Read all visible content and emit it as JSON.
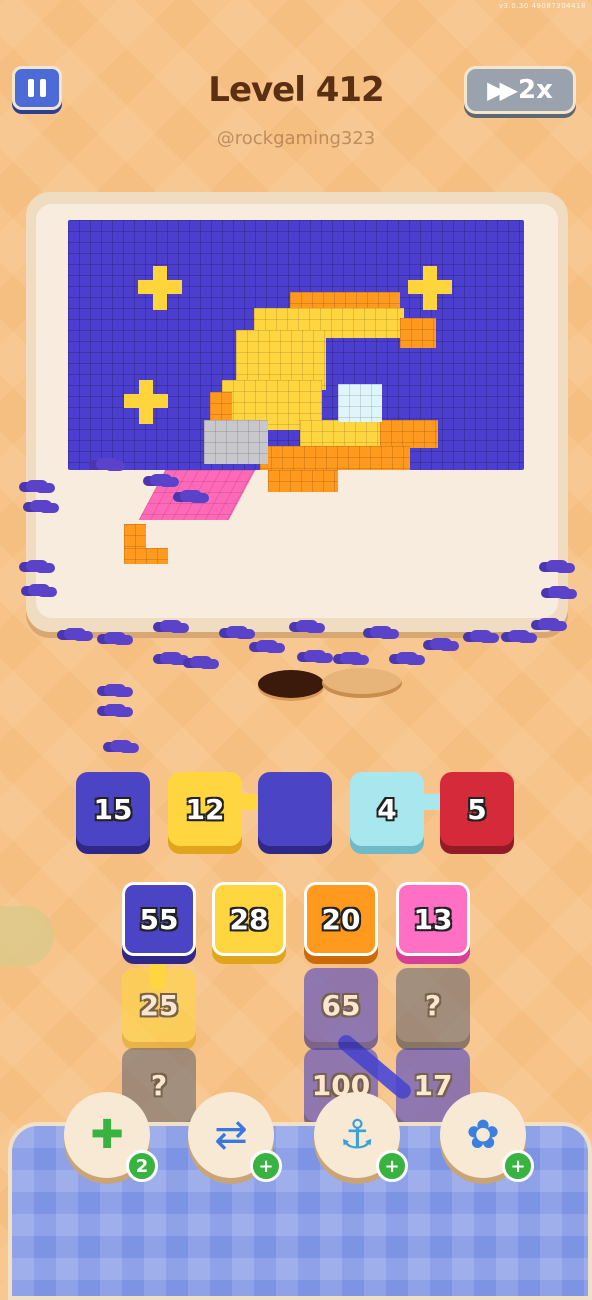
{
  "header": {
    "version": "v3.0.30   49087304418",
    "level_title": "Level 412",
    "handle": "@rockgaming323",
    "speed_label": "2x",
    "pause_icon": "pause-icon",
    "speed_icon": "fast-forward-icon"
  },
  "queue_top": [
    {
      "value": "15",
      "color": "navy"
    },
    {
      "value": "12",
      "color": "yellow"
    },
    {
      "value": "",
      "color": "navy"
    },
    {
      "value": "4",
      "color": "lightblue"
    },
    {
      "value": "5",
      "color": "red"
    }
  ],
  "grid_tiles": [
    {
      "value": "55",
      "color": "navy"
    },
    {
      "value": "28",
      "color": "yellow"
    },
    {
      "value": "20",
      "color": "orange"
    },
    {
      "value": "13",
      "color": "pink"
    },
    {
      "value": "25",
      "color": "yellow"
    },
    {
      "value": "65",
      "color": "navy"
    },
    {
      "value": "?",
      "color": "grey"
    },
    {
      "value": "?",
      "color": "grey"
    },
    {
      "value": "100",
      "color": "navy"
    },
    {
      "value": "17",
      "color": "navy"
    }
  ],
  "boosters": [
    {
      "name": "add-slot-booster",
      "icon": "tray-plus-icon",
      "badge": "2"
    },
    {
      "name": "shuffle-booster",
      "icon": "shuffle-arrows-icon",
      "badge": "+"
    },
    {
      "name": "magnet-claw-booster",
      "icon": "claw-icon",
      "badge": "+"
    },
    {
      "name": "flower-booster",
      "icon": "flower-icon",
      "badge": "+"
    }
  ],
  "colors": {
    "background": "#f6bf82",
    "navy": "#4b44c4",
    "yellow": "#ffd63f",
    "orange": "#ff9a1f",
    "pink": "#ff6fc4",
    "red": "#d52a3a",
    "lightblue": "#a9e7ef",
    "grey": "#6a6a72"
  }
}
